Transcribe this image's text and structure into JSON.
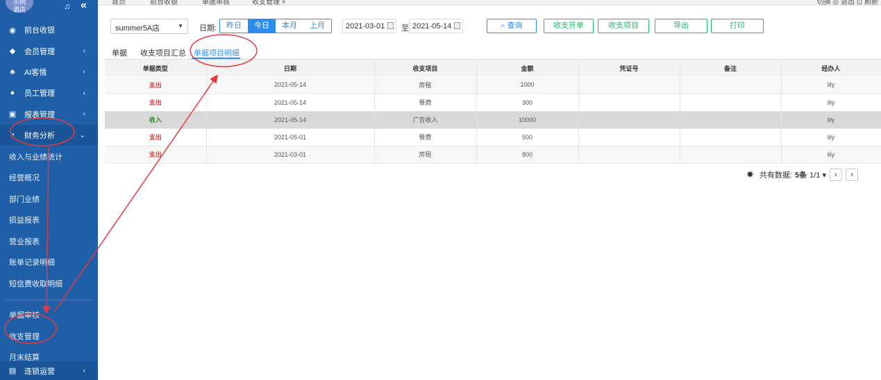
{
  "sidebar": {
    "logo_text": "示例\n酒店",
    "menu": [
      {
        "icon": "◉",
        "icon_name": "cash-register-icon",
        "label": "前台收银"
      },
      {
        "icon": "◆",
        "icon_name": "diamond-icon",
        "label": "会员管理",
        "arrow": "‹"
      },
      {
        "icon": "♣",
        "icon_name": "users-icon",
        "label": "AI客情",
        "arrow": "‹"
      },
      {
        "icon": "●",
        "icon_name": "user-icon",
        "label": "员工管理",
        "arrow": "‹"
      },
      {
        "icon": "▣",
        "icon_name": "monitor-icon",
        "label": "报表管理",
        "arrow": "‹"
      },
      {
        "icon": "◔",
        "icon_name": "pie-chart-icon",
        "label": "财务分析",
        "arrow": "⌄"
      }
    ],
    "submenu": [
      "收入与业绩统计",
      "经营概况",
      "部门业绩",
      "损益报表",
      "营业报表",
      "账单记录明细",
      "短信费收取明细"
    ],
    "submenu2": [
      "单据审核",
      "收支管理",
      "月末结算"
    ],
    "bottom": {
      "icon": "▤",
      "label": "连锁运营",
      "arrow": "‹"
    }
  },
  "tabbar": {
    "tabs": [
      "首页",
      "前台收银",
      "单据审核",
      "收支管理 ×"
    ],
    "right": "切换 ◎  退出 ⊡  刷新"
  },
  "toolbar": {
    "store": "summer5A店",
    "date_label": "日期:",
    "segments": [
      "昨日",
      "今日",
      "本月",
      "上月"
    ],
    "active_segment": "今日",
    "date_from": "2021-03-01",
    "date_sep": "至",
    "date_to": "2021-05-14",
    "search": "查询",
    "buttons": [
      "收支开单",
      "收支项目",
      "导出",
      "打印"
    ]
  },
  "subtabs": [
    "单据",
    "收支项目汇总",
    "单据项目明细"
  ],
  "active_subtab": "单据项目明细",
  "table": {
    "headers": [
      "单据类型",
      "日期",
      "收支项目",
      "金额",
      "凭证号",
      "备注",
      "经办人"
    ],
    "rows": [
      [
        "支出",
        "2021-05-14",
        "房租",
        "1000",
        "",
        "",
        "lily"
      ],
      [
        "支出",
        "2021-05-14",
        "餐费",
        "300",
        "",
        "",
        "lily"
      ],
      [
        "收入",
        "2021-05-14",
        "广告收入",
        "10000",
        "",
        "",
        "lily"
      ],
      [
        "支出",
        "2021-05-01",
        "餐费",
        "500",
        "",
        "",
        "lily"
      ],
      [
        "支出",
        "2021-03-01",
        "房租",
        "800",
        "",
        "",
        "lily"
      ]
    ]
  },
  "pager": {
    "label": "共有数据:",
    "count": "5条",
    "page": "1/1 ▾",
    "prev": "‹",
    "next": "›"
  },
  "colors": {
    "sidebar": "#1f5fa8",
    "accent": "#2d8cf0",
    "green": "#19be6b",
    "annotation": "#e4393c"
  }
}
